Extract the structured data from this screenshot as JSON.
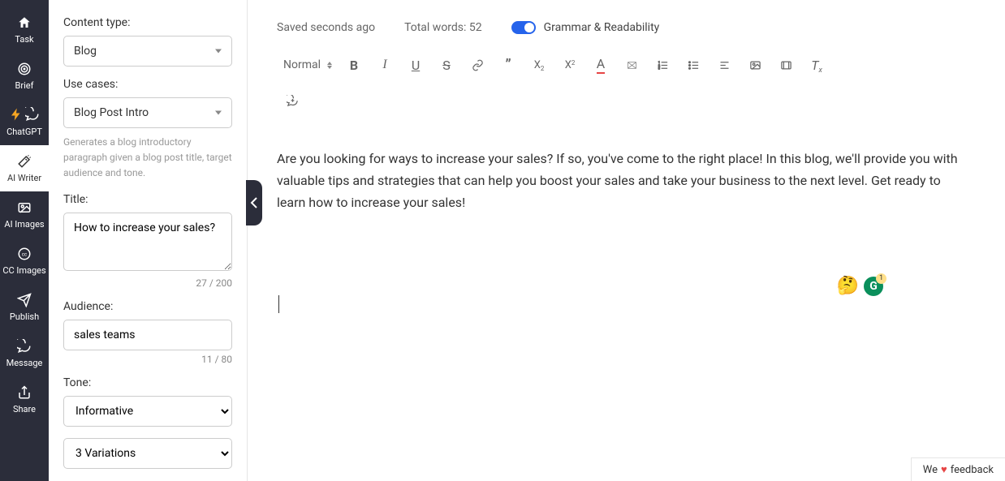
{
  "nav": {
    "items": [
      {
        "label": "Task"
      },
      {
        "label": "Brief"
      },
      {
        "label": "ChatGPT"
      },
      {
        "label": "AI Writer"
      },
      {
        "label": "AI Images"
      },
      {
        "label": "CC Images"
      },
      {
        "label": "Publish"
      },
      {
        "label": "Message"
      },
      {
        "label": "Share"
      }
    ]
  },
  "panel": {
    "content_type_label": "Content type:",
    "content_type_value": "Blog",
    "use_cases_label": "Use cases:",
    "use_cases_value": "Blog Post Intro",
    "use_cases_help": "Generates a blog introductory paragraph given a blog post title, target audience and tone.",
    "title_label": "Title:",
    "title_value": "How to increase your sales?",
    "title_counter": "27 / 200",
    "audience_label": "Audience:",
    "audience_value": "sales teams",
    "audience_counter": "11 / 80",
    "tone_label": "Tone:",
    "tone_value": "Informative",
    "variations_value": "3 Variations"
  },
  "topbar": {
    "saved": "Saved seconds ago",
    "total_words": "Total words: 52",
    "gr_label": "Grammar & Readability"
  },
  "toolbar": {
    "normal": "Normal"
  },
  "content": {
    "text": "Are you looking for ways to increase your sales? If so, you've come to the right place! In this blog, we'll provide you with valuable tips and strategies that can help you boost your sales and take your business to the next level. Get ready to learn how to increase your sales!"
  },
  "grammarly_badge": "1",
  "feedback": {
    "pre": "We",
    "post": "feedback"
  }
}
